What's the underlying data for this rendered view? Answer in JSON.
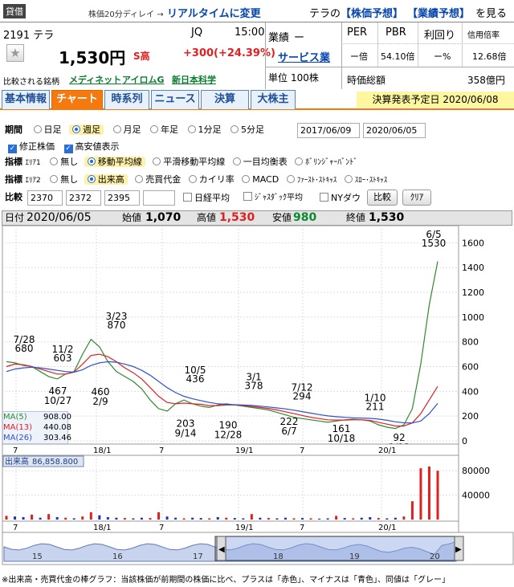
{
  "header": {
    "lending_badge": "貸借",
    "delay_note": "株価20分ディレイ →",
    "realtime_link": "リアルタイムに変更",
    "right_prefix": "テラの",
    "forecast_link1": "【株価予想】",
    "forecast_link2": "【業績予想】",
    "right_suffix": "を見る",
    "code_name": "2191 テラ",
    "market": "JQ",
    "time": "15:00",
    "price": "1,530円",
    "stop_high": "S高",
    "change": "+300",
    "change_pct": "(+24.39%)",
    "compare_label": "比較される銘柄",
    "compare1": "メディネット",
    "compare2": "アイロムG",
    "compare3": "新日本科学",
    "performance_label": "業績",
    "performance_value": "ー",
    "sector": "サービス業",
    "unit_label": "単位",
    "unit_value": "100株",
    "per_label": "PER",
    "pbr_label": "PBR",
    "yield_label": "利回り",
    "margin_label": "信用倍率",
    "per_value": "ー倍",
    "pbr_value": "54.10倍",
    "yield_value": "ー%",
    "margin_value": "12.68倍",
    "mcap_label": "時価総額",
    "mcap_value": "358億円"
  },
  "tabs": [
    "基本情報",
    "チャート",
    "時系列",
    "ニュース",
    "決算",
    "大株主"
  ],
  "earnings_date": "決算発表予定日 2020/06/08",
  "controls": {
    "period_label": "期間",
    "period_options": [
      "日足",
      "週足",
      "月足",
      "年足",
      "1分足",
      "5分足"
    ],
    "date_from": "2017/06/09",
    "date_to": "2020/06/05",
    "adj_price": "修正株価",
    "hl_show": "高安値表示",
    "ind_label": "指標",
    "area1": "ｴﾘｱ1",
    "area1_options": [
      "無し",
      "移動平均線",
      "平滑移動平均線",
      "一目均衡表",
      "ﾎﾞﾘﾝｼﾞｬｰﾊﾞﾝﾄﾞ"
    ],
    "area2": "ｴﾘｱ2",
    "area2_options": [
      "無し",
      "出来高",
      "売買代金",
      "カイリ率",
      "MACD",
      "ﾌｧｰｽﾄ･ｽﾄｷｬｽ",
      "ｽﾛｰ･ｽﾄｷｬｽ"
    ],
    "compare_label": "比較",
    "compare_codes": [
      "2370",
      "2372",
      "2395",
      ""
    ],
    "nikkei": "日経平均",
    "jasdaq": "ｼﾞｬｽﾀﾞｯｸ平均",
    "nydow": "NYダウ",
    "compare_btn": "比較",
    "clear_btn": "ｸﾘｱ"
  },
  "ohlc": {
    "date_label": "日付",
    "date": "2020/06/05",
    "open_label": "始値",
    "open": "1,070",
    "high_label": "高値",
    "high": "1,530",
    "low_label": "安値",
    "low": "980",
    "close_label": "終値",
    "close": "1,530"
  },
  "ma_legend": [
    {
      "label": "MA(5)",
      "value": "908.00"
    },
    {
      "label": "MA(13)",
      "value": "440.08"
    },
    {
      "label": "MA(26)",
      "value": "303.46"
    }
  ],
  "volume_label": "出来高",
  "volume_value": "86,858.800",
  "footnote": "※出来高・売買代金の棒グラフ：当該株価が前期間の株価に比べ、プラスは「赤色」、マイナスは「青色」、同値は「グレー」",
  "colors": {
    "ma5": "#2e8b2e",
    "ma13": "#e02020",
    "ma26": "#3050d0",
    "up": "#e02020",
    "down": "#2030c0",
    "accent": "#f47a10"
  },
  "chart_data": {
    "type": "line",
    "title": "",
    "ylim": [
      0,
      1700
    ],
    "y_ticks": [
      0,
      200,
      400,
      600,
      800,
      1000,
      1200,
      1400,
      1600
    ],
    "vol_ticks": [
      40000,
      80000
    ],
    "x_ticks": [
      "7",
      "18/1",
      "7",
      "19/1",
      "7",
      "20/1"
    ],
    "navigator_ticks": [
      "15",
      "16",
      "17",
      "18",
      "19",
      "20"
    ],
    "annotations": [
      {
        "label": "7/28",
        "value": "680",
        "pos": "above"
      },
      {
        "label": "11/2",
        "value": "603",
        "pos": "above"
      },
      {
        "label": "467",
        "value": "10/27",
        "pos": "below"
      },
      {
        "label": "3/23",
        "value": "870",
        "pos": "above"
      },
      {
        "label": "460",
        "value": "2/9",
        "pos": "below"
      },
      {
        "label": "10/5",
        "value": "436",
        "pos": "above"
      },
      {
        "label": "203",
        "value": "9/14",
        "pos": "below"
      },
      {
        "label": "190",
        "value": "12/28",
        "pos": "below"
      },
      {
        "label": "3/1",
        "value": "378",
        "pos": "above"
      },
      {
        "label": "7/12",
        "value": "294",
        "pos": "above"
      },
      {
        "label": "222",
        "value": "6/7",
        "pos": "below"
      },
      {
        "label": "161",
        "value": "10/18",
        "pos": "below"
      },
      {
        "label": "1/10",
        "value": "211",
        "pos": "above"
      },
      {
        "label": "92",
        "value": "3/13",
        "pos": "below"
      },
      {
        "label": "6/5",
        "value": "1530",
        "pos": "above"
      }
    ],
    "series": [
      {
        "name": "MA(5)",
        "values": [
          640,
          630,
          610,
          600,
          560,
          520,
          500,
          540,
          560,
          700,
          820,
          760,
          640,
          560,
          520,
          480,
          420,
          330,
          260,
          240,
          300,
          330,
          300,
          280,
          270,
          290,
          300,
          290,
          280,
          270,
          260,
          250,
          230,
          210,
          190,
          180,
          170,
          160,
          150,
          160,
          170,
          175,
          170,
          160,
          130,
          110,
          100,
          130,
          260,
          620,
          1100,
          1450
        ]
      },
      {
        "name": "MA(13)",
        "values": [
          600,
          620,
          615,
          600,
          580,
          560,
          540,
          540,
          555,
          620,
          690,
          700,
          680,
          640,
          590,
          550,
          500,
          430,
          360,
          310,
          300,
          305,
          300,
          295,
          285,
          285,
          290,
          290,
          285,
          278,
          270,
          262,
          250,
          235,
          220,
          205,
          190,
          180,
          170,
          168,
          168,
          170,
          170,
          165,
          150,
          135,
          120,
          120,
          145,
          220,
          330,
          440
        ]
      },
      {
        "name": "MA(26)",
        "values": [
          560,
          580,
          590,
          595,
          590,
          580,
          570,
          560,
          555,
          575,
          610,
          630,
          640,
          635,
          620,
          600,
          570,
          530,
          480,
          430,
          390,
          360,
          340,
          325,
          310,
          300,
          295,
          292,
          290,
          286,
          280,
          274,
          266,
          258,
          248,
          236,
          224,
          212,
          202,
          195,
          190,
          186,
          184,
          182,
          176,
          166,
          154,
          146,
          145,
          160,
          220,
          303
        ]
      }
    ],
    "volume": {
      "values": [
        6000,
        5000,
        4000,
        8000,
        3000,
        9000,
        4000,
        3000,
        2000,
        5000,
        12000,
        7000,
        4000,
        3000,
        2500,
        2000,
        3000,
        2500,
        12000,
        5000,
        3000,
        2000,
        3000,
        2500,
        2000,
        4000,
        3000,
        2500,
        2000,
        9000,
        3000,
        2500,
        2000,
        3000,
        2000,
        2500,
        2000,
        1500,
        2000,
        6000,
        2500,
        2000,
        3000,
        4000,
        2500,
        2000,
        3000,
        5000,
        30000,
        84000,
        86858,
        80000
      ],
      "up": [
        1,
        0,
        0,
        1,
        0,
        1,
        0,
        1,
        0,
        1,
        1,
        0,
        0,
        0,
        1,
        0,
        0,
        1,
        1,
        0,
        0,
        1,
        0,
        0,
        1,
        0,
        1,
        0,
        0,
        1,
        0,
        1,
        0,
        0,
        1,
        0,
        1,
        0,
        0,
        1,
        0,
        1,
        0,
        0,
        1,
        0,
        0,
        1,
        1,
        1,
        1,
        1
      ]
    }
  }
}
